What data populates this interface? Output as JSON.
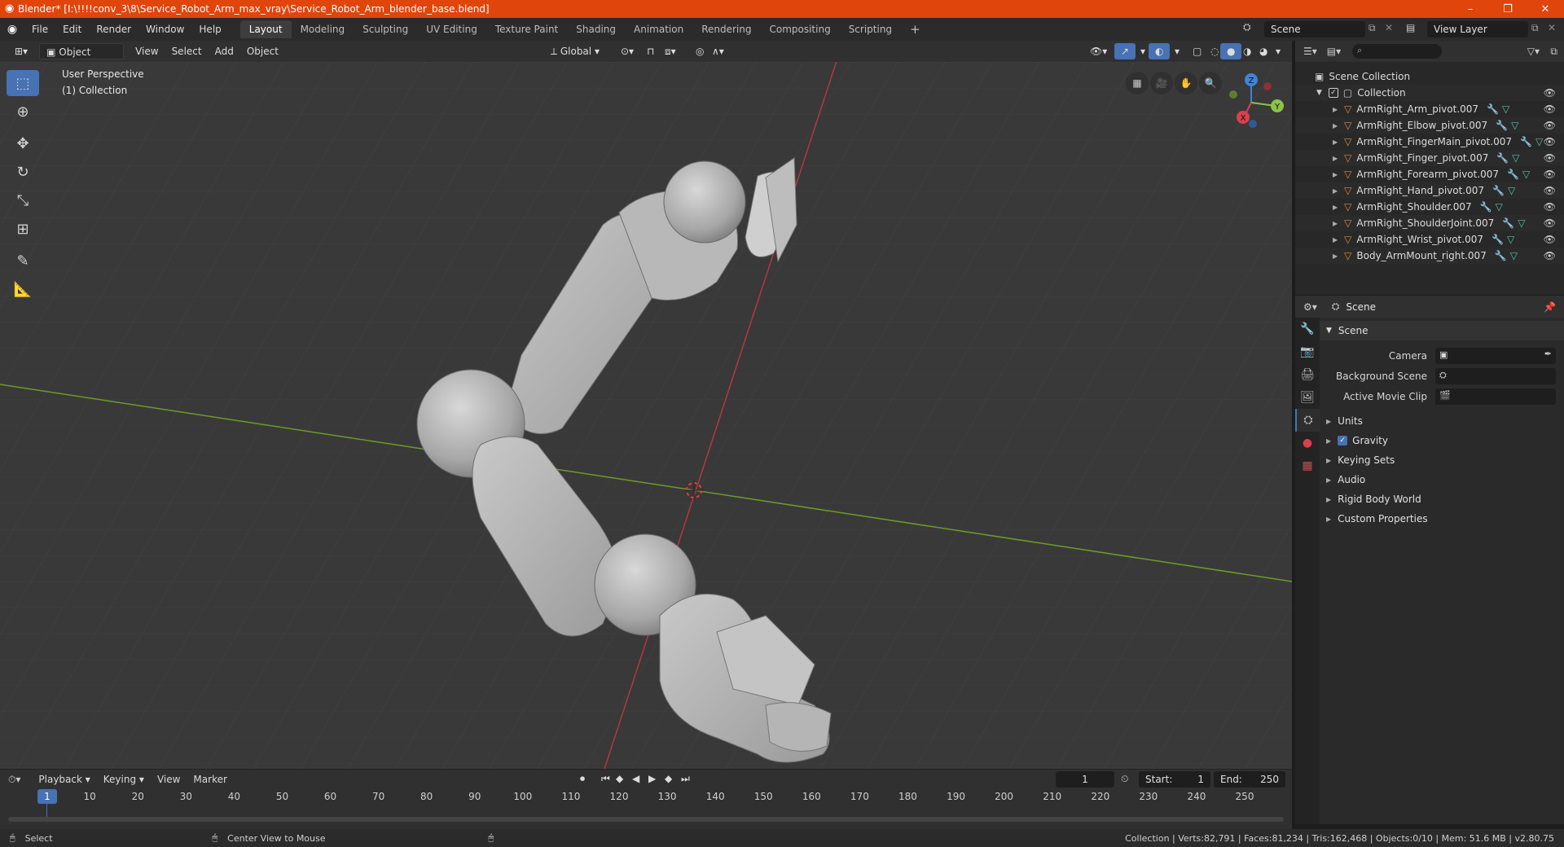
{
  "window": {
    "title": "Blender* [I:\\!!!!conv_3\\8\\Service_Robot_Arm_max_vray\\Service_Robot_Arm_blender_base.blend]",
    "controls": [
      "–",
      "❐",
      "✕"
    ]
  },
  "menus": [
    "File",
    "Edit",
    "Render",
    "Window",
    "Help"
  ],
  "workspaces": [
    "Layout",
    "Modeling",
    "Sculpting",
    "UV Editing",
    "Texture Paint",
    "Shading",
    "Animation",
    "Rendering",
    "Compositing",
    "Scripting"
  ],
  "active_workspace": "Layout",
  "scene_field": "Scene",
  "view_layer_field": "View Layer",
  "viewport_header": {
    "mode": "Object Mode",
    "menus": [
      "View",
      "Select",
      "Add",
      "Object"
    ],
    "orientation": "Global"
  },
  "viewport": {
    "perspective": "User Perspective",
    "collection": "(1) Collection",
    "gizmo_axes": {
      "x": "X",
      "y": "Y",
      "z": "Z"
    }
  },
  "outliner": {
    "root": "Scene Collection",
    "collection": "Collection",
    "objects": [
      "ArmRight_Arm_pivot.007",
      "ArmRight_Elbow_pivot.007",
      "ArmRight_FingerMain_pivot.007",
      "ArmRight_Finger_pivot.007",
      "ArmRight_Forearm_pivot.007",
      "ArmRight_Hand_pivot.007",
      "ArmRight_Shoulder.007",
      "ArmRight_ShoulderJoint.007",
      "ArmRight_Wrist_pivot.007",
      "Body_ArmMount_right.007"
    ]
  },
  "properties": {
    "header": "Scene",
    "panel": "Scene",
    "rows": [
      {
        "label": "Camera"
      },
      {
        "label": "Background Scene"
      },
      {
        "label": "Active Movie Clip"
      }
    ],
    "sections": [
      "Units",
      "Gravity",
      "Keying Sets",
      "Audio",
      "Rigid Body World",
      "Custom Properties"
    ],
    "gravity_checked": true
  },
  "timeline": {
    "menus": [
      "Playback",
      "Keying",
      "View",
      "Marker"
    ],
    "current_frame": "1",
    "start_label": "Start:",
    "start": "1",
    "end_label": "End:",
    "end": "250",
    "ticks": [
      "10",
      "20",
      "30",
      "40",
      "50",
      "60",
      "70",
      "80",
      "90",
      "100",
      "110",
      "120",
      "130",
      "140",
      "150",
      "160",
      "170",
      "180",
      "190",
      "200",
      "210",
      "220",
      "230",
      "240",
      "250"
    ],
    "playhead": "1"
  },
  "statusbar": {
    "left_action": "Select",
    "mid_action": "Center View to Mouse",
    "stats": "Collection | Verts:82,791 | Faces:81,234 | Tris:162,468 | Objects:0/10 | Mem: 51.6 MB | v2.80.75"
  },
  "colors": {
    "title_bar": "#e0450c",
    "accent": "#4772b3",
    "x_axis": "#d9404c",
    "y_axis": "#8bc34a",
    "z_axis": "#3f84d8",
    "object_icon": "#e8883a",
    "mesh_icon": "#52c5a5"
  }
}
